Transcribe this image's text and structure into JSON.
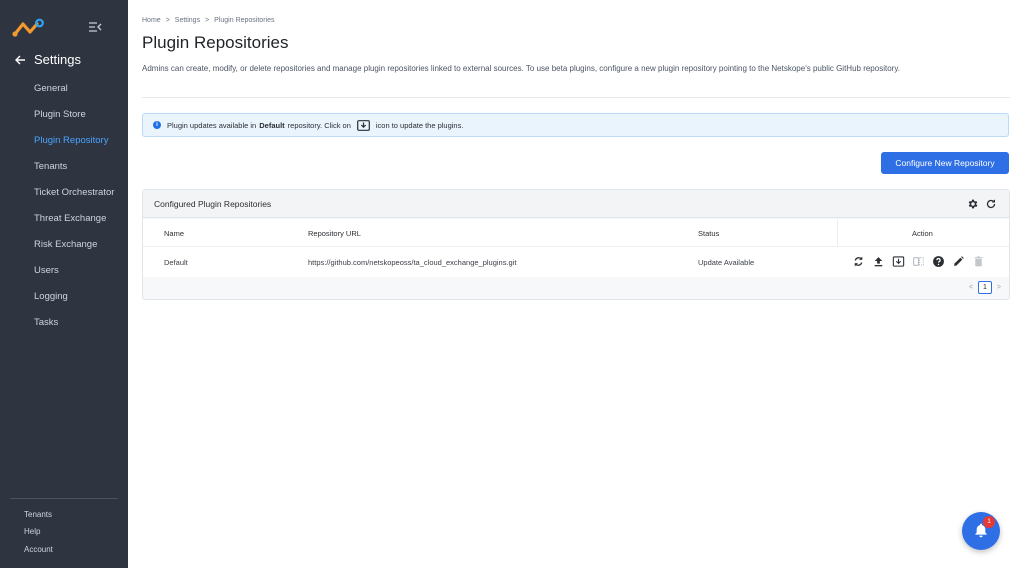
{
  "sidebar": {
    "back_label": "Settings",
    "items": [
      {
        "label": "General"
      },
      {
        "label": "Plugin Store"
      },
      {
        "label": "Plugin Repository"
      },
      {
        "label": "Tenants"
      },
      {
        "label": "Ticket Orchestrator"
      },
      {
        "label": "Threat Exchange"
      },
      {
        "label": "Risk Exchange"
      },
      {
        "label": "Users"
      },
      {
        "label": "Logging"
      },
      {
        "label": "Tasks"
      }
    ],
    "active_index": 2,
    "footer": [
      {
        "label": "Tenants"
      },
      {
        "label": "Help"
      },
      {
        "label": "Account"
      }
    ]
  },
  "breadcrumb": {
    "items": [
      "Home",
      "Settings",
      "Plugin Repositories"
    ],
    "separator": ">"
  },
  "page": {
    "title": "Plugin Repositories",
    "description": "Admins can create, modify, or delete repositories and manage plugin repositories linked to external sources. To use beta plugins, configure a new plugin repository pointing to the Netskope's public GitHub repository."
  },
  "info": {
    "prefix": "Plugin updates available in",
    "bold": "Default",
    "middle": "repository. Click on",
    "suffix": "icon to update the plugins."
  },
  "configure_button": "Configure New Repository",
  "card": {
    "title": "Configured Plugin Repositories",
    "columns": {
      "name": "Name",
      "url": "Repository URL",
      "status": "Status",
      "action": "Action"
    },
    "rows": [
      {
        "name": "Default",
        "url": "https://github.com/netskopeoss/ta_cloud_exchange_plugins.git",
        "status": "Update Available"
      }
    ],
    "pagination": {
      "current": "1",
      "prev": "<",
      "next": ">"
    }
  },
  "notifications": {
    "count": "1"
  },
  "colors": {
    "accent": "#2f6fe6",
    "sidebar_bg": "#2e3440",
    "active_nav": "#4aa3ff",
    "badge": "#e53935"
  },
  "icons": {
    "row_actions": [
      "sync-icon",
      "upload-icon",
      "download-update-icon",
      "compare-icon",
      "help-icon",
      "edit-icon",
      "delete-icon"
    ],
    "card_header": [
      "gear-icon",
      "refresh-icon"
    ]
  }
}
